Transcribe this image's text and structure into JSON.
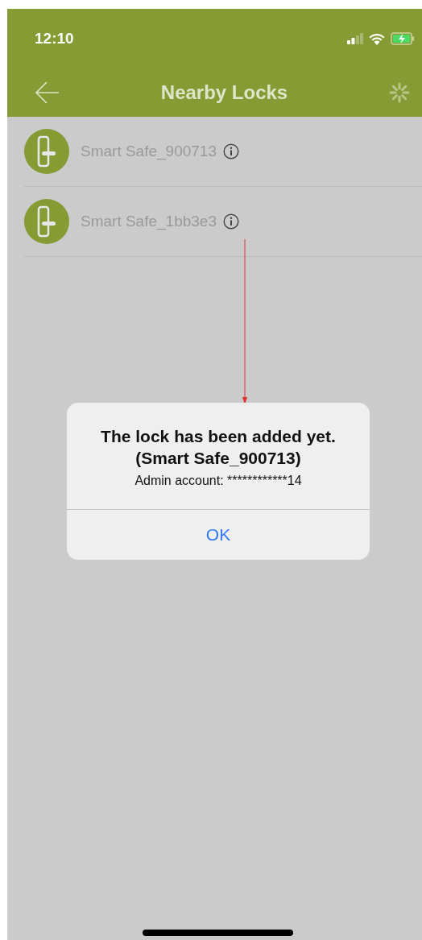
{
  "status_bar": {
    "time": "12:10"
  },
  "nav": {
    "title": "Nearby Locks"
  },
  "locks": [
    {
      "name": "Smart Safe_900713"
    },
    {
      "name": "Smart Safe_1bb3e3"
    }
  ],
  "dialog": {
    "title": "The lock has been added yet.",
    "subtitle": "(Smart Safe_900713)",
    "message": "Admin account: ************14",
    "button": "OK"
  }
}
